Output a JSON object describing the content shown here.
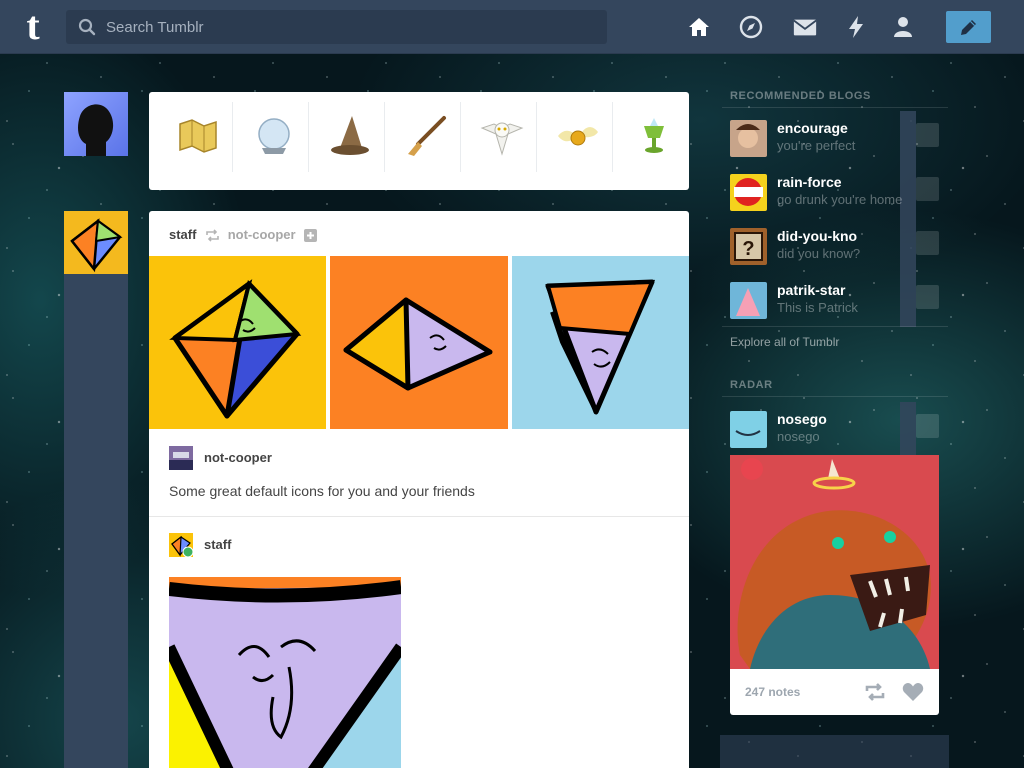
{
  "header": {
    "logo": "t",
    "search_placeholder": "Search Tumblr",
    "nav": [
      "home-icon",
      "explore-icon",
      "inbox-icon",
      "activity-icon",
      "account-icon"
    ],
    "compose": "pencil-icon"
  },
  "icons_tray": [
    "map-icon",
    "crystal-ball-icon",
    "wizard-hat-icon",
    "broomstick-icon",
    "owl-icon",
    "golden-snitch-icon",
    "goblet-icon"
  ],
  "post": {
    "blog": "staff",
    "reblogged_from": "not-cooper",
    "reblog_author": "not-cooper",
    "caption": "Some great default icons for you and your friends",
    "staff_author": "staff"
  },
  "sidebar": {
    "recommended_heading": "RECOMMENDED BLOGS",
    "blogs": [
      {
        "name": "encourage",
        "desc": "you're perfect"
      },
      {
        "name": "rain-force",
        "desc": "go drunk you're home"
      },
      {
        "name": "did-you-kno",
        "desc": "did you know?"
      },
      {
        "name": "patrik-star",
        "desc": "This is Patrick"
      }
    ],
    "explore_label": "Explore all of Tumblr",
    "radar_heading": "RADAR",
    "radar": {
      "name": "nosego",
      "desc": "nosego",
      "notes": "247 notes"
    }
  },
  "colors": {
    "header": "#34465d",
    "compose": "#529ecc",
    "kite_yellow": "#fbc30a",
    "kite_orange": "#fc8123",
    "kite_blue": "#9cd6eb"
  }
}
